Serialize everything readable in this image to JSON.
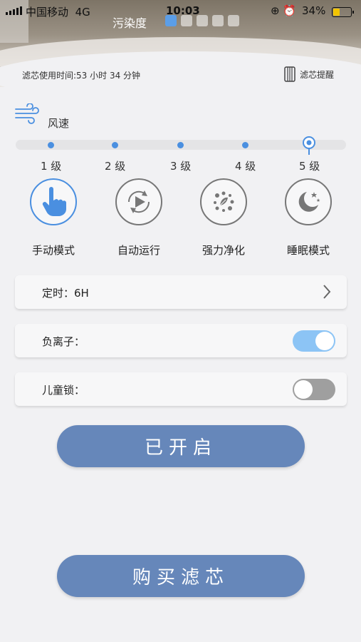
{
  "status_bar": {
    "carrier": "中国移动",
    "network": "4G",
    "time": "10:03",
    "battery": "34%"
  },
  "header": {
    "pollution_label": "污染度",
    "pollution_level": 1,
    "pollution_total": 5,
    "filter_usage": "滤芯使用时间:53 小时 34 分钟",
    "filter_remind_label": "滤芯提醒"
  },
  "wind": {
    "label": "风速",
    "levels": [
      "1 级",
      "2 级",
      "3 级",
      "4 级",
      "5 级"
    ],
    "selected_level": "5 级"
  },
  "modes": [
    {
      "label": "手动模式",
      "icon": "hand-pointer-icon",
      "active": true
    },
    {
      "label": "自动运行",
      "icon": "auto-play-icon",
      "active": false
    },
    {
      "label": "强力净化",
      "icon": "purify-icon",
      "active": false
    },
    {
      "label": "睡眠模式",
      "icon": "moon-icon",
      "active": false
    }
  ],
  "settings": {
    "timer_label": "定时：6H",
    "anion_label": "负离子：",
    "anion_on": true,
    "child_lock_label": "儿童锁：",
    "child_lock_on": false
  },
  "buttons": {
    "power_label": "已开启",
    "buy_filter_label": "购买滤芯"
  },
  "colors": {
    "accent": "#4a8fe0",
    "button": "#6687ba",
    "toggle_on": "#8cc4f5",
    "toggle_off": "#9f9f9f"
  }
}
